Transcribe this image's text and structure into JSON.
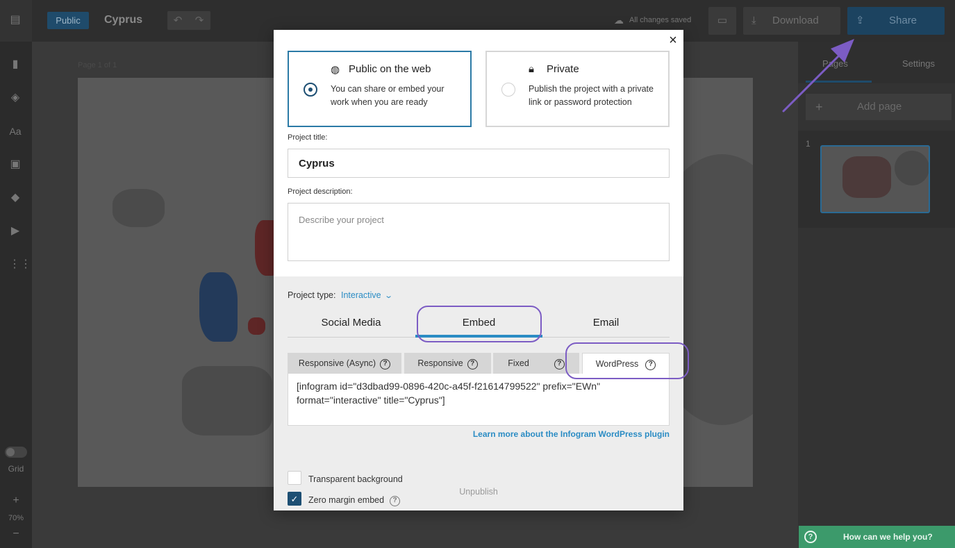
{
  "editor": {
    "public_badge": "Public",
    "project_name": "Cyprus",
    "saved_status": "All changes saved",
    "download_label": "Download",
    "share_label": "Share",
    "page_label": "Page 1 of 1",
    "rail": {
      "grid_label": "Grid",
      "zoom_plus": "+",
      "zoom_value": "70%",
      "zoom_minus": "−"
    },
    "right_panel": {
      "tab_pages": "Pages",
      "tab_settings": "Settings",
      "add_page": "Add page",
      "add_icon": "+",
      "thumb_number": "1"
    },
    "help": {
      "label": "How can we help you?",
      "icon": "?"
    }
  },
  "modal": {
    "close_icon": "×",
    "visibility": {
      "public": {
        "title": "Public on the web",
        "icon": "globe-icon",
        "description": "You can share or embed your work when you are ready",
        "selected": true
      },
      "private": {
        "title": "Private",
        "icon": "lock-icon",
        "description": "Publish the project with a private link or password protection",
        "selected": false
      }
    },
    "project_title_label": "Project title:",
    "project_title_value": "Cyprus",
    "project_description_label": "Project description:",
    "project_description_placeholder": "Describe your project",
    "project_type_label": "Project type:",
    "project_type_value": "Interactive",
    "share_tabs": [
      "Social Media",
      "Embed",
      "Email"
    ],
    "share_tab_active": "Embed",
    "embed_tabs": [
      "Responsive (Async)",
      "Responsive",
      "Fixed",
      "WordPress"
    ],
    "embed_tab_active": "WordPress",
    "help_mark": "?",
    "embed_code": "[infogram id=\"d3dbad99-0896-420c-a45f-f21614799522\" prefix=\"EWn\" format=\"interactive\" title=\"Cyprus\"]",
    "learn_more": "Learn more about the Infogram WordPress plugin",
    "transparent_background_label": "Transparent background",
    "transparent_background_checked": false,
    "zero_margin_label": "Zero margin embed",
    "zero_margin_checked": true,
    "check_mark": "✓",
    "unpublish_label": "Unpublish"
  },
  "colors": {
    "accent": "#2b8cc4",
    "dark_accent": "#1d4f73",
    "annotation": "#7c5cc4",
    "help_green": "#3c9a6b"
  }
}
